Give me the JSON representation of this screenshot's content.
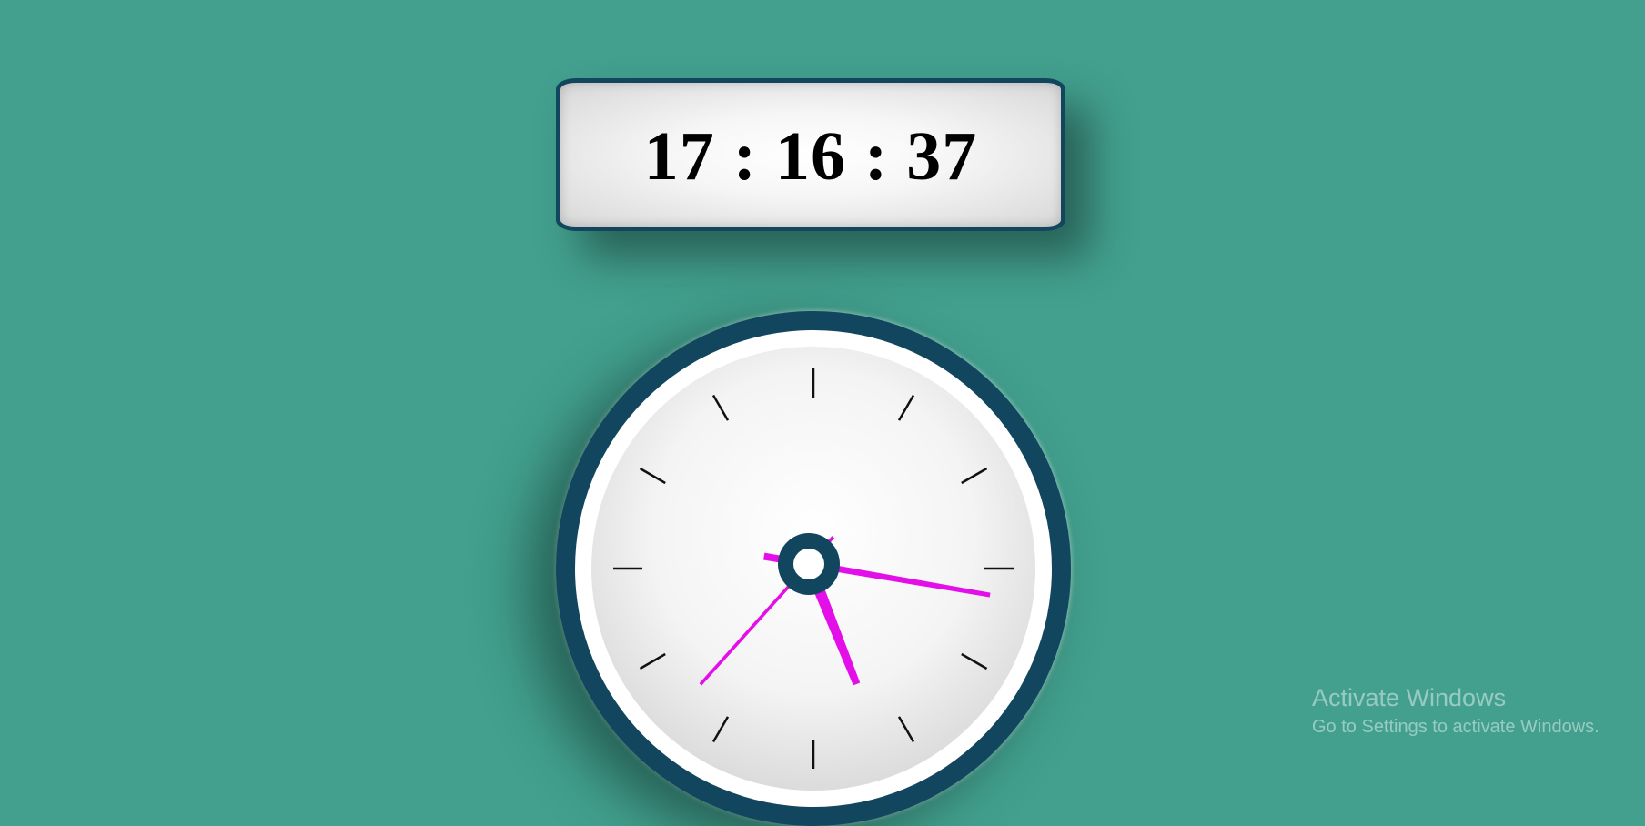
{
  "digital_clock": {
    "time_text": "17 : 16 : 37"
  },
  "analog_clock": {
    "hours": 17,
    "minutes": 16,
    "seconds": 37,
    "hand_color": "#e40ee8",
    "ring_color": "#11465e",
    "tick_color": "#111111"
  },
  "watermark": {
    "title": "Activate Windows",
    "subtitle": "Go to Settings to activate Windows."
  },
  "colors": {
    "background": "#43a08e",
    "accent_dark": "#11465e"
  }
}
